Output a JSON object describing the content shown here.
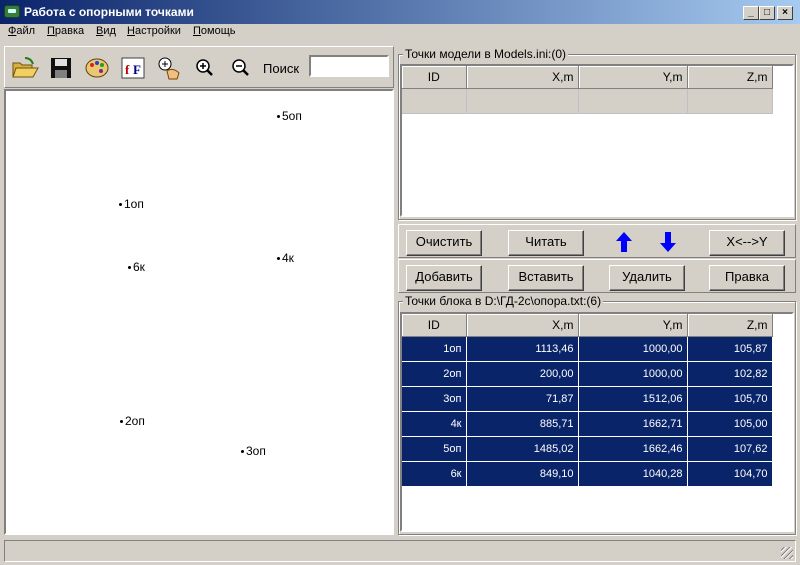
{
  "window": {
    "title": "Работа с опорными точками",
    "btn_min": "_",
    "btn_max": "□",
    "btn_close": "×"
  },
  "menu": [
    "Файл",
    "Правка",
    "Вид",
    "Настройки",
    "Помощь"
  ],
  "toolbar": {
    "search_label": "Поиск",
    "search_value": ""
  },
  "canvas_points": [
    {
      "label": "5оп"
    },
    {
      "label": "1оп"
    },
    {
      "label": "6к"
    },
    {
      "label": "4к"
    },
    {
      "label": "2оп"
    },
    {
      "label": "3оп"
    }
  ],
  "model_panel": {
    "title": "Точки модели в Models.ini:(0)",
    "columns": [
      "ID",
      "X,m",
      "Y,m",
      "Z,m"
    ]
  },
  "actions_row1": {
    "clear": "Очистить",
    "read": "Читать",
    "swap": "X<-->Y"
  },
  "actions_row2": {
    "add": "Добавить",
    "insert": "Вставить",
    "delete": "Удалить",
    "edit": "Правка"
  },
  "block_panel": {
    "title": "Точки блока в D:\\ГД-2с\\опора.txt:(6)",
    "columns": [
      "ID",
      "X,m",
      "Y,m",
      "Z,m"
    ],
    "rows": [
      [
        "1оп",
        "1113,46",
        "1000,00",
        "105,87"
      ],
      [
        "2оп",
        "200,00",
        "1000,00",
        "102,82"
      ],
      [
        "3оп",
        "71,87",
        "1512,06",
        "105,70"
      ],
      [
        "4к",
        "885,71",
        "1662,71",
        "105,00"
      ],
      [
        "5оп",
        "1485,02",
        "1662,46",
        "107,62"
      ],
      [
        "6к",
        "849,10",
        "1040,28",
        "104,70"
      ]
    ]
  },
  "colors": {
    "selection": "#0a246a",
    "arrow": "#0000ff"
  }
}
